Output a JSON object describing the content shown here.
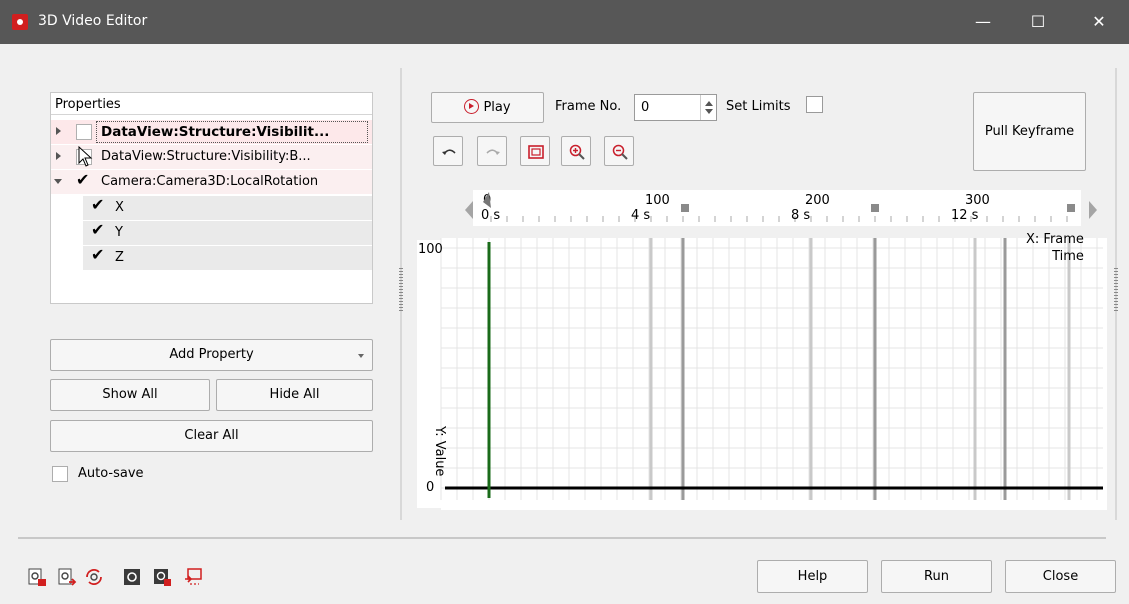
{
  "window": {
    "title": "3D Video Editor",
    "accent": "#575757",
    "minimize": "—",
    "maximize": "☐",
    "close": "✕"
  },
  "properties": {
    "header": "Properties",
    "items": [
      {
        "label": "DataView:Structure:Visibilit...",
        "checked": false,
        "expanded": false
      },
      {
        "label": "DataView:Structure:Visibility:B...",
        "checked": false,
        "expanded": false
      },
      {
        "label": "Camera:Camera3D:LocalRotation",
        "checked": true,
        "expanded": true,
        "children": [
          {
            "label": "X",
            "checked": true
          },
          {
            "label": "Y",
            "checked": true
          },
          {
            "label": "Z",
            "checked": true
          }
        ]
      }
    ]
  },
  "buttons": {
    "add_property": "Add Property",
    "show_all": "Show All",
    "hide_all": "Hide All",
    "clear_all": "Clear All",
    "play": "Play",
    "pull_keyframe": "Pull Keyframe",
    "help": "Help",
    "run": "Run",
    "close": "Close"
  },
  "autosave": {
    "label": "Auto-save",
    "checked": false
  },
  "frame": {
    "label": "Frame No.",
    "value": "0"
  },
  "set_limits": {
    "label": "Set Limits",
    "checked": false
  },
  "toolbar_icons": [
    "undo-icon",
    "redo-icon",
    "fit-view-icon",
    "zoom-in-icon",
    "zoom-out-icon"
  ],
  "timeline": {
    "frame_ticks": [
      "0",
      "100",
      "200",
      "300"
    ],
    "time_ticks": [
      "0 s",
      "4 s",
      "8 s",
      "12 s"
    ],
    "x_axis_label_line1": "X: Frame",
    "x_axis_label_line2": "Time",
    "y_axis_label": "Y: Value",
    "y_max": "100",
    "y_min": "0",
    "current_frame_color": "#1a6b1a"
  },
  "bottom_icons": [
    "import-keyframes-icon",
    "export-keyframes-icon",
    "sync-icon",
    "settings-dark-icon",
    "settings-red-icon",
    "screen-capture-icon"
  ]
}
